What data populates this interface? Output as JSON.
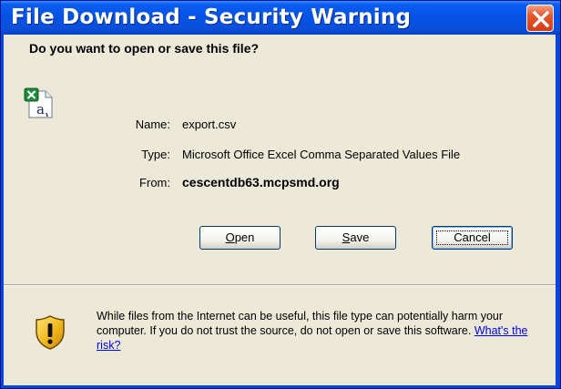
{
  "window": {
    "title": "File Download - Security Warning",
    "close_glyph": "X"
  },
  "dialog": {
    "question": "Do you want to open or save this file?",
    "file_icon": "excel-csv-file-icon",
    "fields": {
      "name_label": "Name:",
      "name_value": "export.csv",
      "type_label": "Type:",
      "type_value": "Microsoft Office Excel Comma Separated Values File",
      "from_label": "From:",
      "from_value": "cescentdb63.mcpsmd.org"
    },
    "buttons": {
      "open_hotkey": "O",
      "open_rest": "pen",
      "save_hotkey": "S",
      "save_rest": "ave",
      "cancel_label": "Cancel"
    },
    "warning": {
      "icon": "security-shield-warning-icon",
      "text": "While files from the Internet can be useful, this file type can potentially harm your computer. If you do not trust the source, do not open or save this software. ",
      "link_label": "What's the risk?"
    }
  },
  "colors": {
    "title_bar": "#0653e6",
    "close_button": "#d33e17",
    "dialog_background": "#ece9d8",
    "link": "#0000ff"
  }
}
